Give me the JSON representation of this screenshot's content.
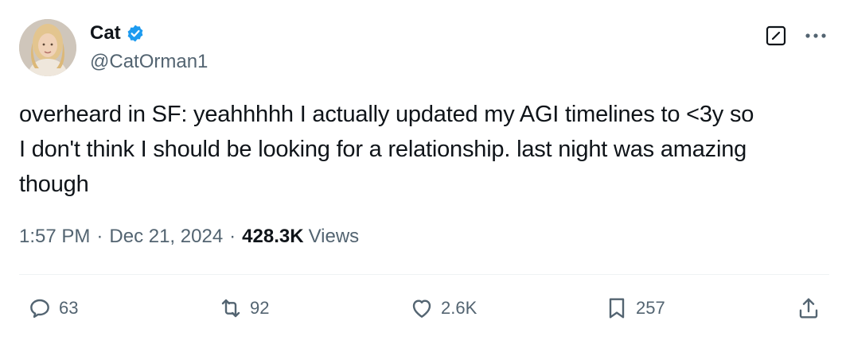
{
  "author": {
    "display_name": "Cat",
    "handle": "@CatOrman1",
    "verified": true
  },
  "icons": {
    "verified": "verified-badge-icon",
    "grok": "grok-icon",
    "more": "more-dots-icon",
    "reply": "reply-icon",
    "repost": "repost-icon",
    "like": "like-heart-icon",
    "bookmark": "bookmark-icon",
    "share": "share-icon"
  },
  "tweet": {
    "text": "overheard in SF: yeahhhhh I actually updated my AGI timelines to <3y so\nI don't think I should be looking for a relationship. last night was amazing\nthough"
  },
  "meta": {
    "time": "1:57 PM",
    "separator": "·",
    "date": "Dec 21, 2024",
    "views_count": "428.3K",
    "views_label": "Views"
  },
  "actions": {
    "replies": "63",
    "reposts": "92",
    "likes": "2.6K",
    "bookmarks": "257"
  },
  "colors": {
    "text_primary": "#0f1419",
    "text_secondary": "#536471",
    "verified_blue": "#1d9bf0",
    "divider": "#eff3f4"
  }
}
